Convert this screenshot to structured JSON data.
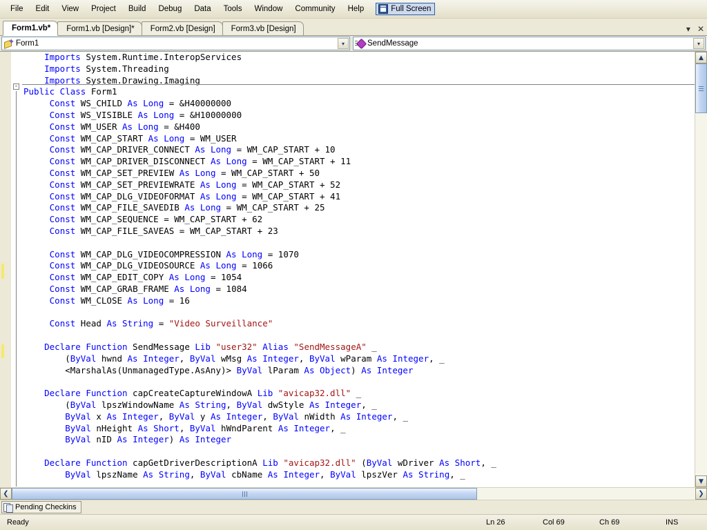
{
  "menubar": {
    "items": [
      {
        "label": "File"
      },
      {
        "label": "Edit"
      },
      {
        "label": "View"
      },
      {
        "label": "Project"
      },
      {
        "label": "Build"
      },
      {
        "label": "Debug"
      },
      {
        "label": "Data"
      },
      {
        "label": "Tools"
      },
      {
        "label": "Window"
      },
      {
        "label": "Community"
      },
      {
        "label": "Help"
      }
    ],
    "fullscreen": {
      "label": "Full Screen",
      "icon": "fullscreen-icon"
    }
  },
  "tabs": [
    {
      "label": "Form1.vb*",
      "active": true
    },
    {
      "label": "Form1.vb [Design]*",
      "active": false
    },
    {
      "label": "Form2.vb [Design]",
      "active": false
    },
    {
      "label": "Form3.vb [Design]",
      "active": false
    }
  ],
  "tab_controls": {
    "dropdown_icon": "chevron-down-icon",
    "dropdown_glyph": "▾",
    "close_icon": "close-icon",
    "close_glyph": "✕"
  },
  "navbar": {
    "class_combo": {
      "value": "Form1",
      "icon": "class-icon",
      "arrow_glyph": "▾"
    },
    "member_combo": {
      "value": "SendMessage",
      "icon": "method-icon",
      "arrow_glyph": "▾"
    }
  },
  "editor": {
    "fold_glyph": "-",
    "lines": [
      [
        {
          "t": "    ",
          "c": "id"
        },
        {
          "t": "Imports",
          "c": "kw"
        },
        {
          "t": " System.Runtime.InteropServices",
          "c": "id"
        }
      ],
      [
        {
          "t": "    ",
          "c": "id"
        },
        {
          "t": "Imports",
          "c": "kw"
        },
        {
          "t": " System.Threading",
          "c": "id"
        }
      ],
      [
        {
          "t": "    ",
          "c": "id"
        },
        {
          "t": "Imports",
          "c": "kw"
        },
        {
          "t": " System.Drawing.Imaging",
          "c": "id"
        }
      ],
      [
        {
          "t": "Public Class",
          "c": "kw"
        },
        {
          "t": " Form1",
          "c": "id"
        }
      ],
      [
        {
          "t": "     ",
          "c": "id"
        },
        {
          "t": "Const",
          "c": "kw"
        },
        {
          "t": " WS_CHILD ",
          "c": "id"
        },
        {
          "t": "As Long",
          "c": "kw"
        },
        {
          "t": " = &H40000000",
          "c": "id"
        }
      ],
      [
        {
          "t": "     ",
          "c": "id"
        },
        {
          "t": "Const",
          "c": "kw"
        },
        {
          "t": " WS_VISIBLE ",
          "c": "id"
        },
        {
          "t": "As Long",
          "c": "kw"
        },
        {
          "t": " = &H10000000",
          "c": "id"
        }
      ],
      [
        {
          "t": "     ",
          "c": "id"
        },
        {
          "t": "Const",
          "c": "kw"
        },
        {
          "t": " WM_USER ",
          "c": "id"
        },
        {
          "t": "As Long",
          "c": "kw"
        },
        {
          "t": " = &H400",
          "c": "id"
        }
      ],
      [
        {
          "t": "     ",
          "c": "id"
        },
        {
          "t": "Const",
          "c": "kw"
        },
        {
          "t": " WM_CAP_START ",
          "c": "id"
        },
        {
          "t": "As Long",
          "c": "kw"
        },
        {
          "t": " = WM_USER",
          "c": "id"
        }
      ],
      [
        {
          "t": "     ",
          "c": "id"
        },
        {
          "t": "Const",
          "c": "kw"
        },
        {
          "t": " WM_CAP_DRIVER_CONNECT ",
          "c": "id"
        },
        {
          "t": "As Long",
          "c": "kw"
        },
        {
          "t": " = WM_CAP_START + 10",
          "c": "id"
        }
      ],
      [
        {
          "t": "     ",
          "c": "id"
        },
        {
          "t": "Const",
          "c": "kw"
        },
        {
          "t": " WM_CAP_DRIVER_DISCONNECT ",
          "c": "id"
        },
        {
          "t": "As Long",
          "c": "kw"
        },
        {
          "t": " = WM_CAP_START + 11",
          "c": "id"
        }
      ],
      [
        {
          "t": "     ",
          "c": "id"
        },
        {
          "t": "Const",
          "c": "kw"
        },
        {
          "t": " WM_CAP_SET_PREVIEW ",
          "c": "id"
        },
        {
          "t": "As Long",
          "c": "kw"
        },
        {
          "t": " = WM_CAP_START + 50",
          "c": "id"
        }
      ],
      [
        {
          "t": "     ",
          "c": "id"
        },
        {
          "t": "Const",
          "c": "kw"
        },
        {
          "t": " WM_CAP_SET_PREVIEWRATE ",
          "c": "id"
        },
        {
          "t": "As Long",
          "c": "kw"
        },
        {
          "t": " = WM_CAP_START + 52",
          "c": "id"
        }
      ],
      [
        {
          "t": "     ",
          "c": "id"
        },
        {
          "t": "Const",
          "c": "kw"
        },
        {
          "t": " WM_CAP_DLG_VIDEOFORMAT ",
          "c": "id"
        },
        {
          "t": "As Long",
          "c": "kw"
        },
        {
          "t": " = WM_CAP_START + 41",
          "c": "id"
        }
      ],
      [
        {
          "t": "     ",
          "c": "id"
        },
        {
          "t": "Const",
          "c": "kw"
        },
        {
          "t": " WM_CAP_FILE_SAVEDIB ",
          "c": "id"
        },
        {
          "t": "As Long",
          "c": "kw"
        },
        {
          "t": " = WM_CAP_START + 25",
          "c": "id"
        }
      ],
      [
        {
          "t": "     ",
          "c": "id"
        },
        {
          "t": "Const",
          "c": "kw"
        },
        {
          "t": " WM_CAP_SEQUENCE = WM_CAP_START + 62",
          "c": "id"
        }
      ],
      [
        {
          "t": "     ",
          "c": "id"
        },
        {
          "t": "Const",
          "c": "kw"
        },
        {
          "t": " WM_CAP_FILE_SAVEAS = WM_CAP_START + 23",
          "c": "id"
        }
      ],
      [],
      [
        {
          "t": "     ",
          "c": "id"
        },
        {
          "t": "Const",
          "c": "kw"
        },
        {
          "t": " WM_CAP_DLG_VIDEOCOMPRESSION ",
          "c": "id"
        },
        {
          "t": "As Long",
          "c": "kw"
        },
        {
          "t": " = 1070",
          "c": "id"
        }
      ],
      [
        {
          "t": "     ",
          "c": "id"
        },
        {
          "t": "Const",
          "c": "kw"
        },
        {
          "t": " WM_CAP_DLG_VIDEOSOURCE ",
          "c": "id"
        },
        {
          "t": "As Long",
          "c": "kw"
        },
        {
          "t": " = 1066",
          "c": "id"
        }
      ],
      [
        {
          "t": "     ",
          "c": "id"
        },
        {
          "t": "Const",
          "c": "kw"
        },
        {
          "t": " WM_CAP_EDIT_COPY ",
          "c": "id"
        },
        {
          "t": "As Long",
          "c": "kw"
        },
        {
          "t": " = 1054",
          "c": "id"
        }
      ],
      [
        {
          "t": "     ",
          "c": "id"
        },
        {
          "t": "Const",
          "c": "kw"
        },
        {
          "t": " WM_CAP_GRAB_FRAME ",
          "c": "id"
        },
        {
          "t": "As Long",
          "c": "kw"
        },
        {
          "t": " = 1084",
          "c": "id"
        }
      ],
      [
        {
          "t": "     ",
          "c": "id"
        },
        {
          "t": "Const",
          "c": "kw"
        },
        {
          "t": " WM_CLOSE ",
          "c": "id"
        },
        {
          "t": "As Long",
          "c": "kw"
        },
        {
          "t": " = 16",
          "c": "id"
        }
      ],
      [],
      [
        {
          "t": "     ",
          "c": "id"
        },
        {
          "t": "Const",
          "c": "kw"
        },
        {
          "t": " Head ",
          "c": "id"
        },
        {
          "t": "As String",
          "c": "kw"
        },
        {
          "t": " = ",
          "c": "id"
        },
        {
          "t": "\"Video Surveillance\"",
          "c": "str"
        }
      ],
      [],
      [
        {
          "t": "    ",
          "c": "id"
        },
        {
          "t": "Declare Function",
          "c": "kw"
        },
        {
          "t": " SendMessage ",
          "c": "id"
        },
        {
          "t": "Lib",
          "c": "kw"
        },
        {
          "t": " ",
          "c": "id"
        },
        {
          "t": "\"user32\"",
          "c": "str"
        },
        {
          "t": " ",
          "c": "id"
        },
        {
          "t": "Alias",
          "c": "kw"
        },
        {
          "t": " ",
          "c": "id"
        },
        {
          "t": "\"SendMessageA\"",
          "c": "str"
        },
        {
          "t": " _",
          "c": "id"
        }
      ],
      [
        {
          "t": "        (",
          "c": "id"
        },
        {
          "t": "ByVal",
          "c": "kw"
        },
        {
          "t": " hwnd ",
          "c": "id"
        },
        {
          "t": "As Integer",
          "c": "kw"
        },
        {
          "t": ", ",
          "c": "id"
        },
        {
          "t": "ByVal",
          "c": "kw"
        },
        {
          "t": " wMsg ",
          "c": "id"
        },
        {
          "t": "As Integer",
          "c": "kw"
        },
        {
          "t": ", ",
          "c": "id"
        },
        {
          "t": "ByVal",
          "c": "kw"
        },
        {
          "t": " wParam ",
          "c": "id"
        },
        {
          "t": "As Integer",
          "c": "kw"
        },
        {
          "t": ", _",
          "c": "id"
        }
      ],
      [
        {
          "t": "        <MarshalAs(UnmanagedType.AsAny)> ",
          "c": "id"
        },
        {
          "t": "ByVal",
          "c": "kw"
        },
        {
          "t": " lParam ",
          "c": "id"
        },
        {
          "t": "As Object",
          "c": "kw"
        },
        {
          "t": ") ",
          "c": "id"
        },
        {
          "t": "As Integer",
          "c": "kw"
        }
      ],
      [],
      [
        {
          "t": "    ",
          "c": "id"
        },
        {
          "t": "Declare Function",
          "c": "kw"
        },
        {
          "t": " capCreateCaptureWindowA ",
          "c": "id"
        },
        {
          "t": "Lib",
          "c": "kw"
        },
        {
          "t": " ",
          "c": "id"
        },
        {
          "t": "\"avicap32.dll\"",
          "c": "str"
        },
        {
          "t": " _",
          "c": "id"
        }
      ],
      [
        {
          "t": "        (",
          "c": "id"
        },
        {
          "t": "ByVal",
          "c": "kw"
        },
        {
          "t": " lpszWindowName ",
          "c": "id"
        },
        {
          "t": "As String",
          "c": "kw"
        },
        {
          "t": ", ",
          "c": "id"
        },
        {
          "t": "ByVal",
          "c": "kw"
        },
        {
          "t": " dwStyle ",
          "c": "id"
        },
        {
          "t": "As Integer",
          "c": "kw"
        },
        {
          "t": ", _",
          "c": "id"
        }
      ],
      [
        {
          "t": "        ",
          "c": "id"
        },
        {
          "t": "ByVal",
          "c": "kw"
        },
        {
          "t": " x ",
          "c": "id"
        },
        {
          "t": "As Integer",
          "c": "kw"
        },
        {
          "t": ", ",
          "c": "id"
        },
        {
          "t": "ByVal",
          "c": "kw"
        },
        {
          "t": " y ",
          "c": "id"
        },
        {
          "t": "As Integer",
          "c": "kw"
        },
        {
          "t": ", ",
          "c": "id"
        },
        {
          "t": "ByVal",
          "c": "kw"
        },
        {
          "t": " nWidth ",
          "c": "id"
        },
        {
          "t": "As Integer",
          "c": "kw"
        },
        {
          "t": ", _",
          "c": "id"
        }
      ],
      [
        {
          "t": "        ",
          "c": "id"
        },
        {
          "t": "ByVal",
          "c": "kw"
        },
        {
          "t": " nHeight ",
          "c": "id"
        },
        {
          "t": "As Short",
          "c": "kw"
        },
        {
          "t": ", ",
          "c": "id"
        },
        {
          "t": "ByVal",
          "c": "kw"
        },
        {
          "t": " hWndParent ",
          "c": "id"
        },
        {
          "t": "As Integer",
          "c": "kw"
        },
        {
          "t": ", _",
          "c": "id"
        }
      ],
      [
        {
          "t": "        ",
          "c": "id"
        },
        {
          "t": "ByVal",
          "c": "kw"
        },
        {
          "t": " nID ",
          "c": "id"
        },
        {
          "t": "As Integer",
          "c": "kw"
        },
        {
          "t": ") ",
          "c": "id"
        },
        {
          "t": "As Integer",
          "c": "kw"
        }
      ],
      [],
      [
        {
          "t": "    ",
          "c": "id"
        },
        {
          "t": "Declare Function",
          "c": "kw"
        },
        {
          "t": " capGetDriverDescriptionA ",
          "c": "id"
        },
        {
          "t": "Lib",
          "c": "kw"
        },
        {
          "t": " ",
          "c": "id"
        },
        {
          "t": "\"avicap32.dll\"",
          "c": "str"
        },
        {
          "t": " (",
          "c": "id"
        },
        {
          "t": "ByVal",
          "c": "kw"
        },
        {
          "t": " wDriver ",
          "c": "id"
        },
        {
          "t": "As Short",
          "c": "kw"
        },
        {
          "t": ", _",
          "c": "id"
        }
      ],
      [
        {
          "t": "        ",
          "c": "id"
        },
        {
          "t": "ByVal",
          "c": "kw"
        },
        {
          "t": " lpszName ",
          "c": "id"
        },
        {
          "t": "As String",
          "c": "kw"
        },
        {
          "t": ", ",
          "c": "id"
        },
        {
          "t": "ByVal",
          "c": "kw"
        },
        {
          "t": " cbName ",
          "c": "id"
        },
        {
          "t": "As Integer",
          "c": "kw"
        },
        {
          "t": ", ",
          "c": "id"
        },
        {
          "t": "ByVal",
          "c": "kw"
        },
        {
          "t": " lpszVer ",
          "c": "id"
        },
        {
          "t": "As String",
          "c": "kw"
        },
        {
          "t": ", _",
          "c": "id"
        }
      ]
    ]
  },
  "scrollbars": {
    "vertical": {
      "up_glyph": "▲",
      "down_glyph": "▼"
    },
    "horizontal": {
      "left_glyph": "❮",
      "right_glyph": "❯"
    }
  },
  "checkins": {
    "label": "Pending Checkins",
    "icon": "pending-checkins-icon"
  },
  "statusbar": {
    "ready": "Ready",
    "line": "Ln 26",
    "column": "Col 69",
    "character": "Ch 69",
    "insert_mode": "INS"
  },
  "colors": {
    "keyword": "#0000ff",
    "string": "#a31515",
    "comment": "#008000",
    "chrome": "#ece9d8",
    "accent": "#2d5fa8",
    "change_mark": "#f7e96a"
  }
}
